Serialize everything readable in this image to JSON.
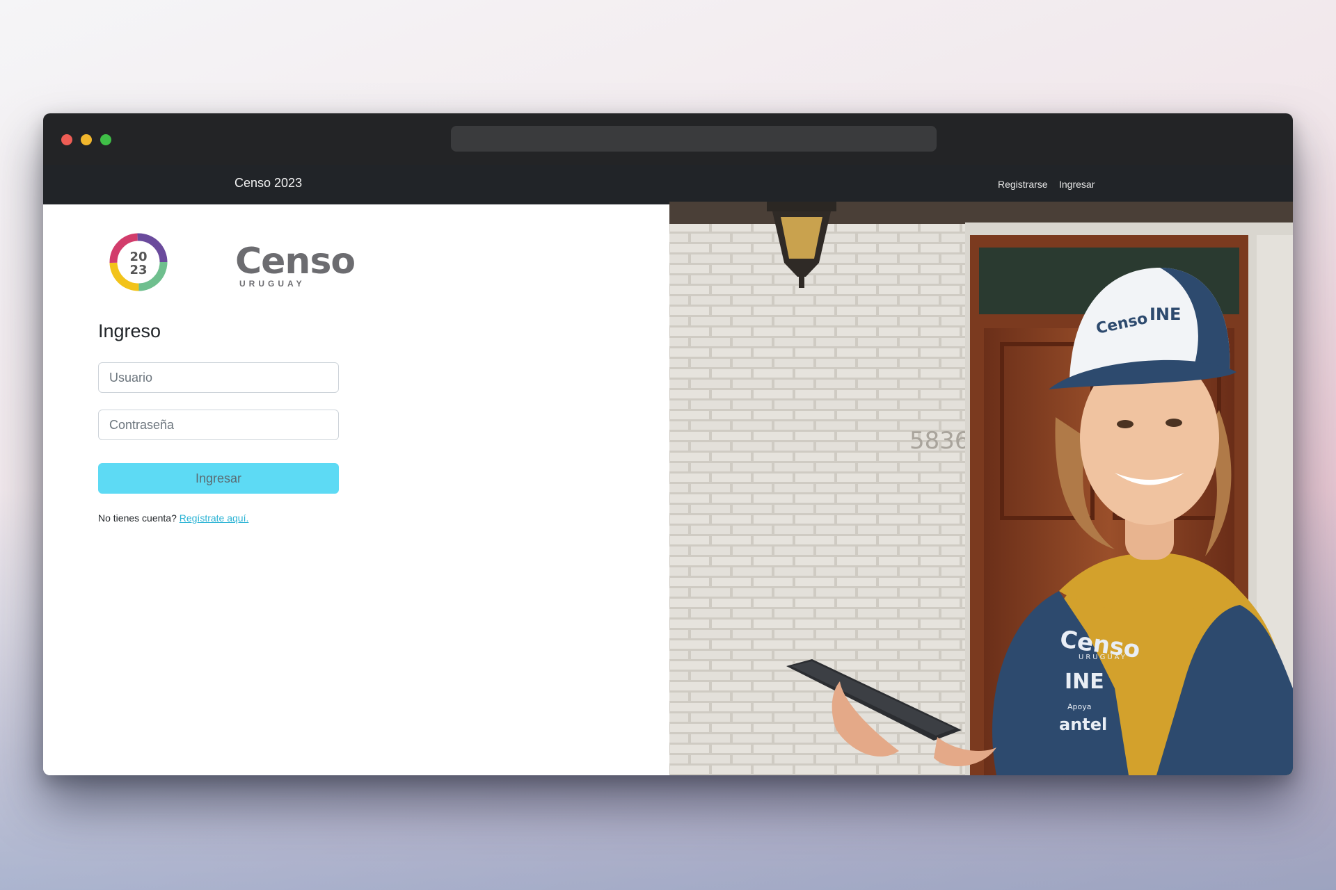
{
  "navbar": {
    "brand": "Censo 2023",
    "links": {
      "register": "Registrarse",
      "login": "Ingresar"
    }
  },
  "logo": {
    "year_top": "20",
    "year_bottom": "23",
    "word": "Censo",
    "subtitle": "URUGUAY"
  },
  "login": {
    "heading": "Ingreso",
    "username_placeholder": "Usuario",
    "password_placeholder": "Contraseña",
    "submit_label": "Ingresar",
    "no_account_text": "No tienes cuenta?",
    "register_link": "Regístrate aquí."
  },
  "hero": {
    "house_number": "5836",
    "cap_brand": "Censo",
    "cap_org": "INE",
    "vest_brand": "Censo",
    "vest_subtitle": "URUGUAY",
    "vest_org": "INE",
    "vest_support": "Apoya",
    "vest_sponsor": "antel"
  },
  "colors": {
    "navbar": "#212428",
    "titlebar": "#232426",
    "button": "#5ddaf4",
    "link": "#2bb3d4",
    "vest": "#2d4a6e",
    "shirt": "#d3a12c"
  },
  "icons": [
    "close-window-icon",
    "minimize-window-icon",
    "maximize-window-icon"
  ]
}
